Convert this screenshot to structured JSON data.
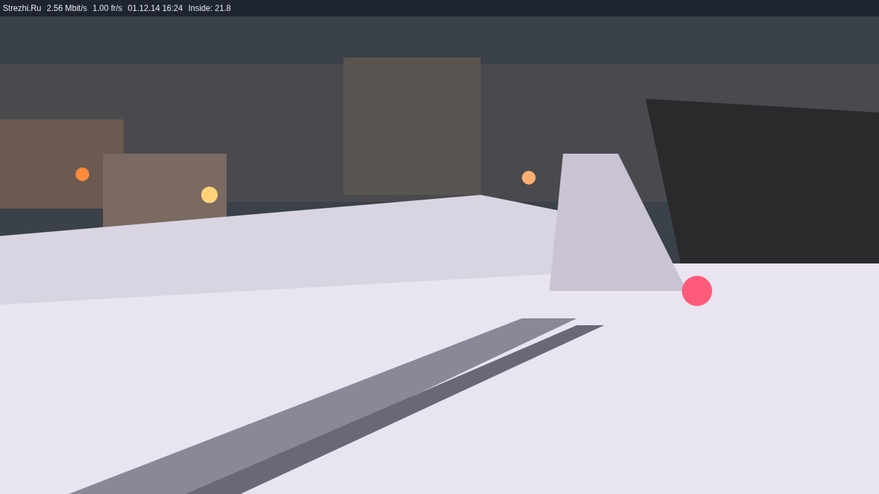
{
  "status_bar": {
    "items": [
      "Strezhi.Ru",
      "2.56 Mbit/s",
      "1.00 fr/s",
      "01.12.14 16:24",
      "Inside: 21.8"
    ]
  }
}
